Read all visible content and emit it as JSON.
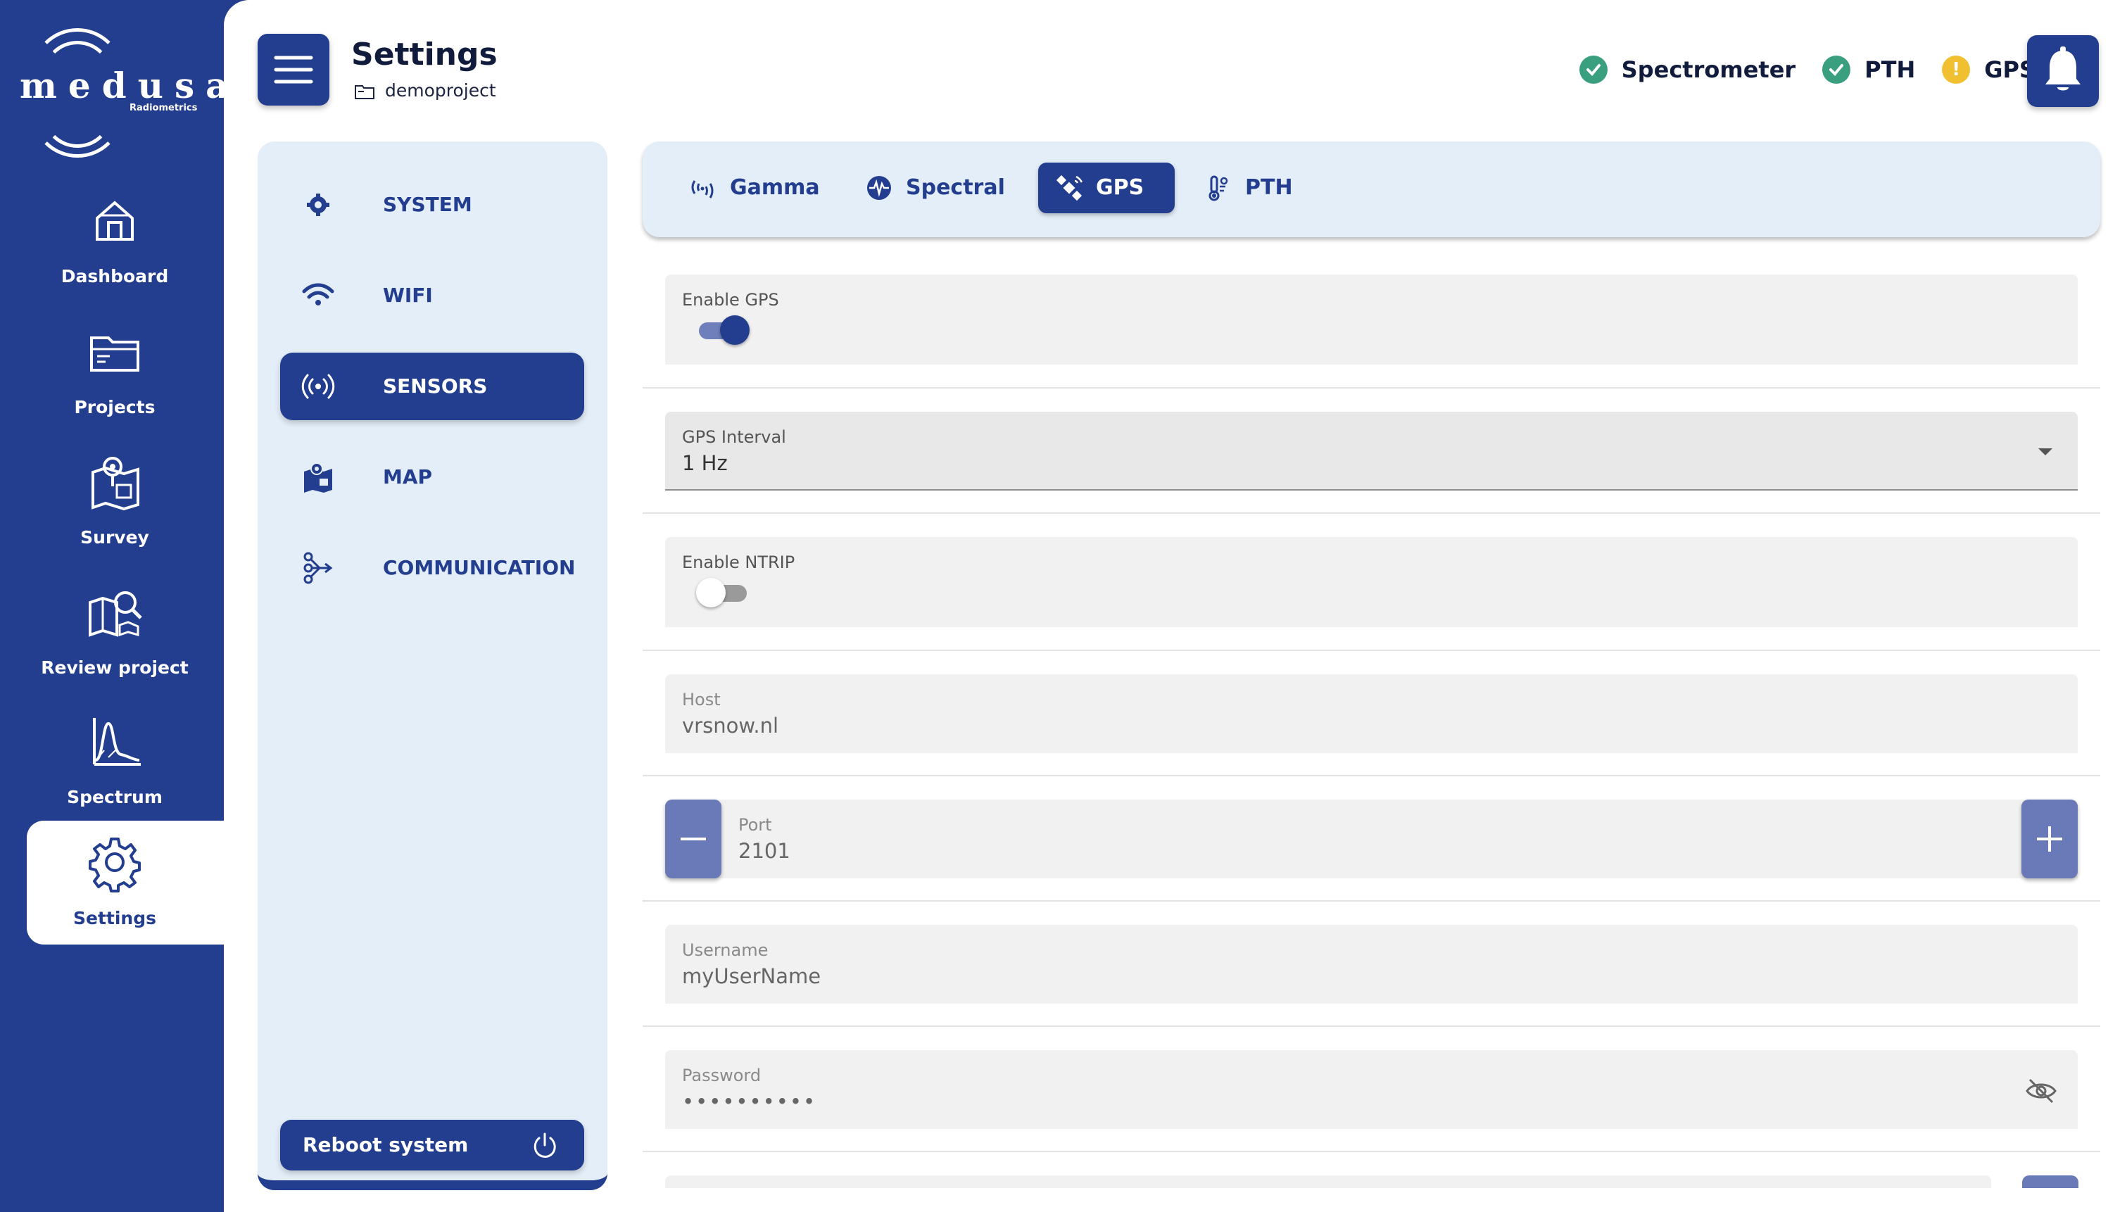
{
  "brand": {
    "name": "medusa",
    "sub": "Radiometrics"
  },
  "nav": {
    "items": [
      {
        "label": "Dashboard",
        "icon": "home-icon"
      },
      {
        "label": "Projects",
        "icon": "folder-icon"
      },
      {
        "label": "Survey",
        "icon": "survey-map-icon"
      },
      {
        "label": "Review project",
        "icon": "map-search-icon"
      },
      {
        "label": "Spectrum",
        "icon": "spectrum-chart-icon"
      },
      {
        "label": "Settings",
        "icon": "gear-icon",
        "active": true
      }
    ]
  },
  "header": {
    "title": "Settings",
    "project": "demoproject",
    "statuses": [
      {
        "label": "Spectrometer",
        "state": "ok",
        "color": "#3a9f7f"
      },
      {
        "label": "PTH",
        "state": "ok",
        "color": "#3a9f7f"
      },
      {
        "label": "GPS",
        "state": "warning",
        "color": "#f0c030",
        "glyph": "!"
      }
    ]
  },
  "categories": [
    {
      "label": "SYSTEM",
      "icon": "gear-icon"
    },
    {
      "label": "WIFI",
      "icon": "wifi-icon"
    },
    {
      "label": "SENSORS",
      "icon": "sensor-broadcast-icon",
      "active": true
    },
    {
      "label": "MAP",
      "icon": "map-icon"
    },
    {
      "label": "COMMUNICATION",
      "icon": "share-network-icon"
    }
  ],
  "reboot": {
    "label": "Reboot system"
  },
  "tabs": [
    {
      "label": "Gamma",
      "icon": "radiation-wave-icon"
    },
    {
      "label": "Spectral",
      "icon": "pulse-icon"
    },
    {
      "label": "GPS",
      "icon": "satellite-icon",
      "active": true
    },
    {
      "label": "PTH",
      "icon": "thermometer-icon"
    }
  ],
  "gps_form": {
    "enable_gps": {
      "label": "Enable GPS",
      "on": true
    },
    "interval": {
      "label": "GPS Interval",
      "value": "1 Hz"
    },
    "enable_ntrip": {
      "label": "Enable NTRIP",
      "on": false
    },
    "host": {
      "label": "Host",
      "value": "vrsnow.nl"
    },
    "port": {
      "label": "Port",
      "value": "2101"
    },
    "username": {
      "label": "Username",
      "value": "myUserName"
    },
    "password": {
      "label": "Password",
      "value": "••••••••••"
    }
  },
  "colors": {
    "primary": "#233d8f",
    "panel": "#e4eef8",
    "ok": "#3a9f7f",
    "warning": "#f0c030"
  }
}
